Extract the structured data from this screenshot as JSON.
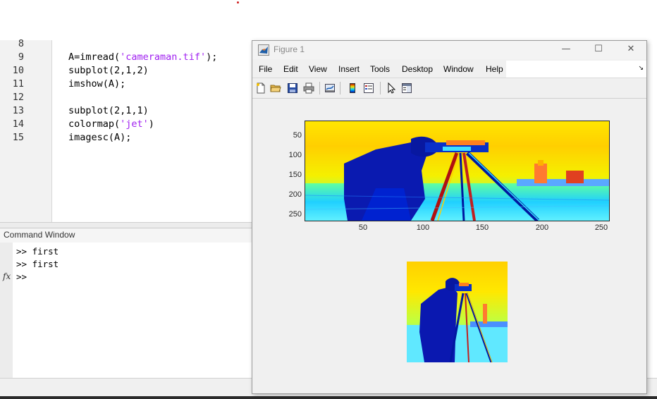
{
  "editor": {
    "lines": [
      {
        "num": "8",
        "code": ""
      },
      {
        "num": "9",
        "code": "A=imread(",
        "str": "'cameraman.tif'",
        "rest": ");"
      },
      {
        "num": "10",
        "code": "subplot(2,1,2)"
      },
      {
        "num": "11",
        "code": "imshow(A);"
      },
      {
        "num": "12",
        "code": ""
      },
      {
        "num": "13",
        "code": "subplot(2,1,1)"
      },
      {
        "num": "14",
        "code": "colormap(",
        "str": "'jet'",
        "rest": ")"
      },
      {
        "num": "15",
        "code": "imagesc(A);"
      }
    ]
  },
  "command_window": {
    "title": "Command Window",
    "lines": [
      ">> first",
      ">> first",
      ">>"
    ],
    "fx_icon": "fx"
  },
  "figure": {
    "title": "Figure 1",
    "menus": [
      "File",
      "Edit",
      "View",
      "Insert",
      "Tools",
      "Desktop",
      "Window",
      "Help"
    ],
    "toolbar_icons": [
      "new-figure-icon",
      "open-file-icon",
      "save-icon",
      "print-icon",
      "link-plot-icon",
      "insert-colorbar-icon",
      "insert-legend-icon",
      "edit-plot-icon",
      "property-inspector-icon"
    ],
    "window_controls": {
      "minimize": "—",
      "maximize": "☐",
      "close": "✕"
    },
    "colormap": "jet"
  },
  "chart_data": [
    {
      "type": "heatmap",
      "description_source": "imagesc(A) of cameraman.tif with jet colormap",
      "yticks": [
        "50",
        "100",
        "150",
        "200",
        "250"
      ],
      "xticks": [
        "50",
        "100",
        "150",
        "200",
        "250"
      ],
      "xlim": [
        0.5,
        256.5
      ],
      "ylim": [
        0.5,
        256.5
      ]
    },
    {
      "type": "heatmap",
      "description_source": "imshow(A) of cameraman.tif rendered with jet colormap",
      "xticks": [],
      "yticks": []
    }
  ]
}
